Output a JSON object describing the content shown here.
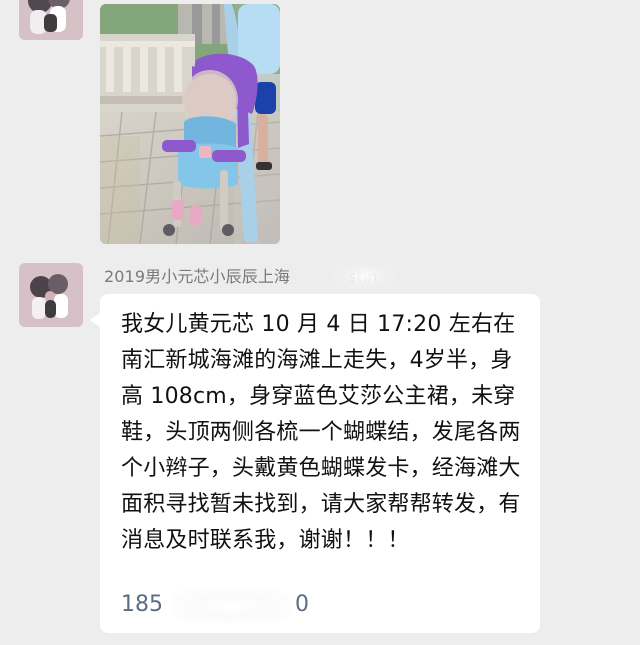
{
  "chat": {
    "message": {
      "sender_name": "2019男小元芯小辰辰上海",
      "sender_suffix": "stin",
      "text": "我女儿黄元芯 10 月 4 日 17:20 左右在南汇新城海滩的海滩上走失，4岁半，身高 108cm，身穿蓝色艾莎公主裙，未穿鞋，头顶两侧各梳一个蝴蝶结，发尾各两个小辫子，头戴黄色蝴蝶发卡，经海滩大面积寻找暂未找到，请大家帮帮转发，有消息及时联系我，谢谢！！！",
      "phone_prefix": "185",
      "phone_suffix": "0"
    }
  },
  "colors": {
    "background": "#ededed",
    "bubble": "#ffffff",
    "sender_text": "#7a7a7a",
    "message_text": "#111111",
    "phone_text": "#5b6c86"
  },
  "icons": {
    "avatar": "avatar-icon",
    "photo": "photo-thumbnail"
  }
}
